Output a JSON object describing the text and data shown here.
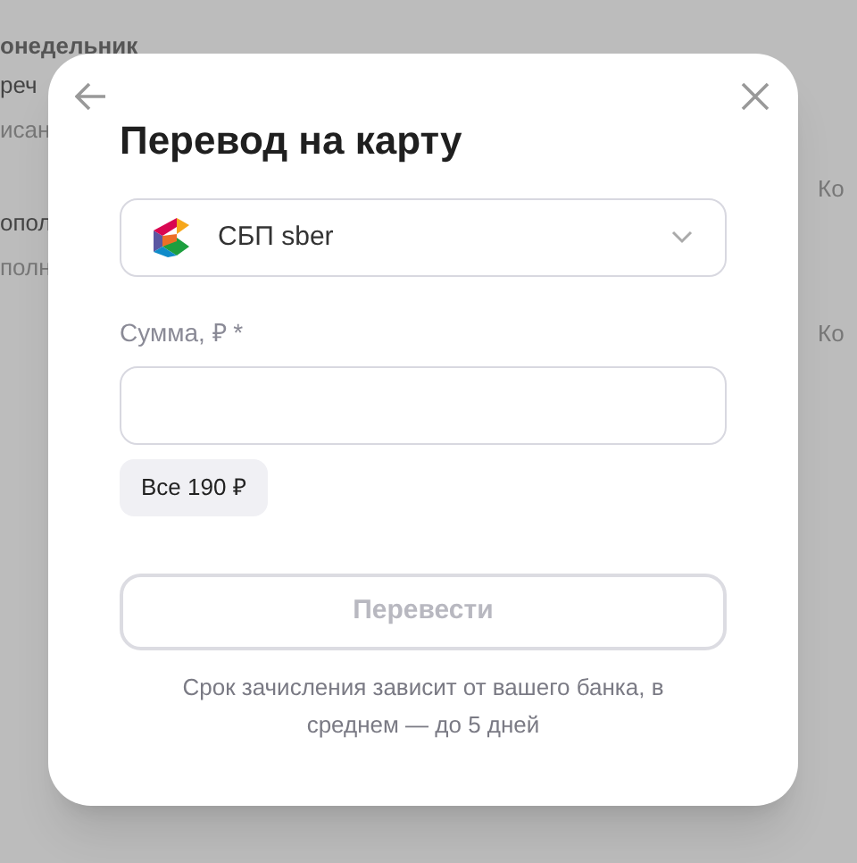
{
  "background": {
    "left_texts": [
      {
        "text": "онедельник",
        "kind": "heading"
      },
      {
        "text": "реч",
        "kind": "title"
      },
      {
        "text": "исан",
        "kind": "sub"
      },
      {
        "text": "опол",
        "kind": "title"
      },
      {
        "text": "полн",
        "kind": "sub"
      }
    ],
    "right_texts": [
      "Ко",
      "Ко"
    ]
  },
  "dialog": {
    "title": "Перевод на карту",
    "method": {
      "value": "СБП sber"
    },
    "amount": {
      "label": "Сумма, ₽ *"
    },
    "quick_amount": "Все 190 ₽",
    "submit": {
      "label": "Перевести",
      "disabled": true
    },
    "note": "Срок зачисления зависит от вашего банка, в среднем — до 5 дней"
  }
}
